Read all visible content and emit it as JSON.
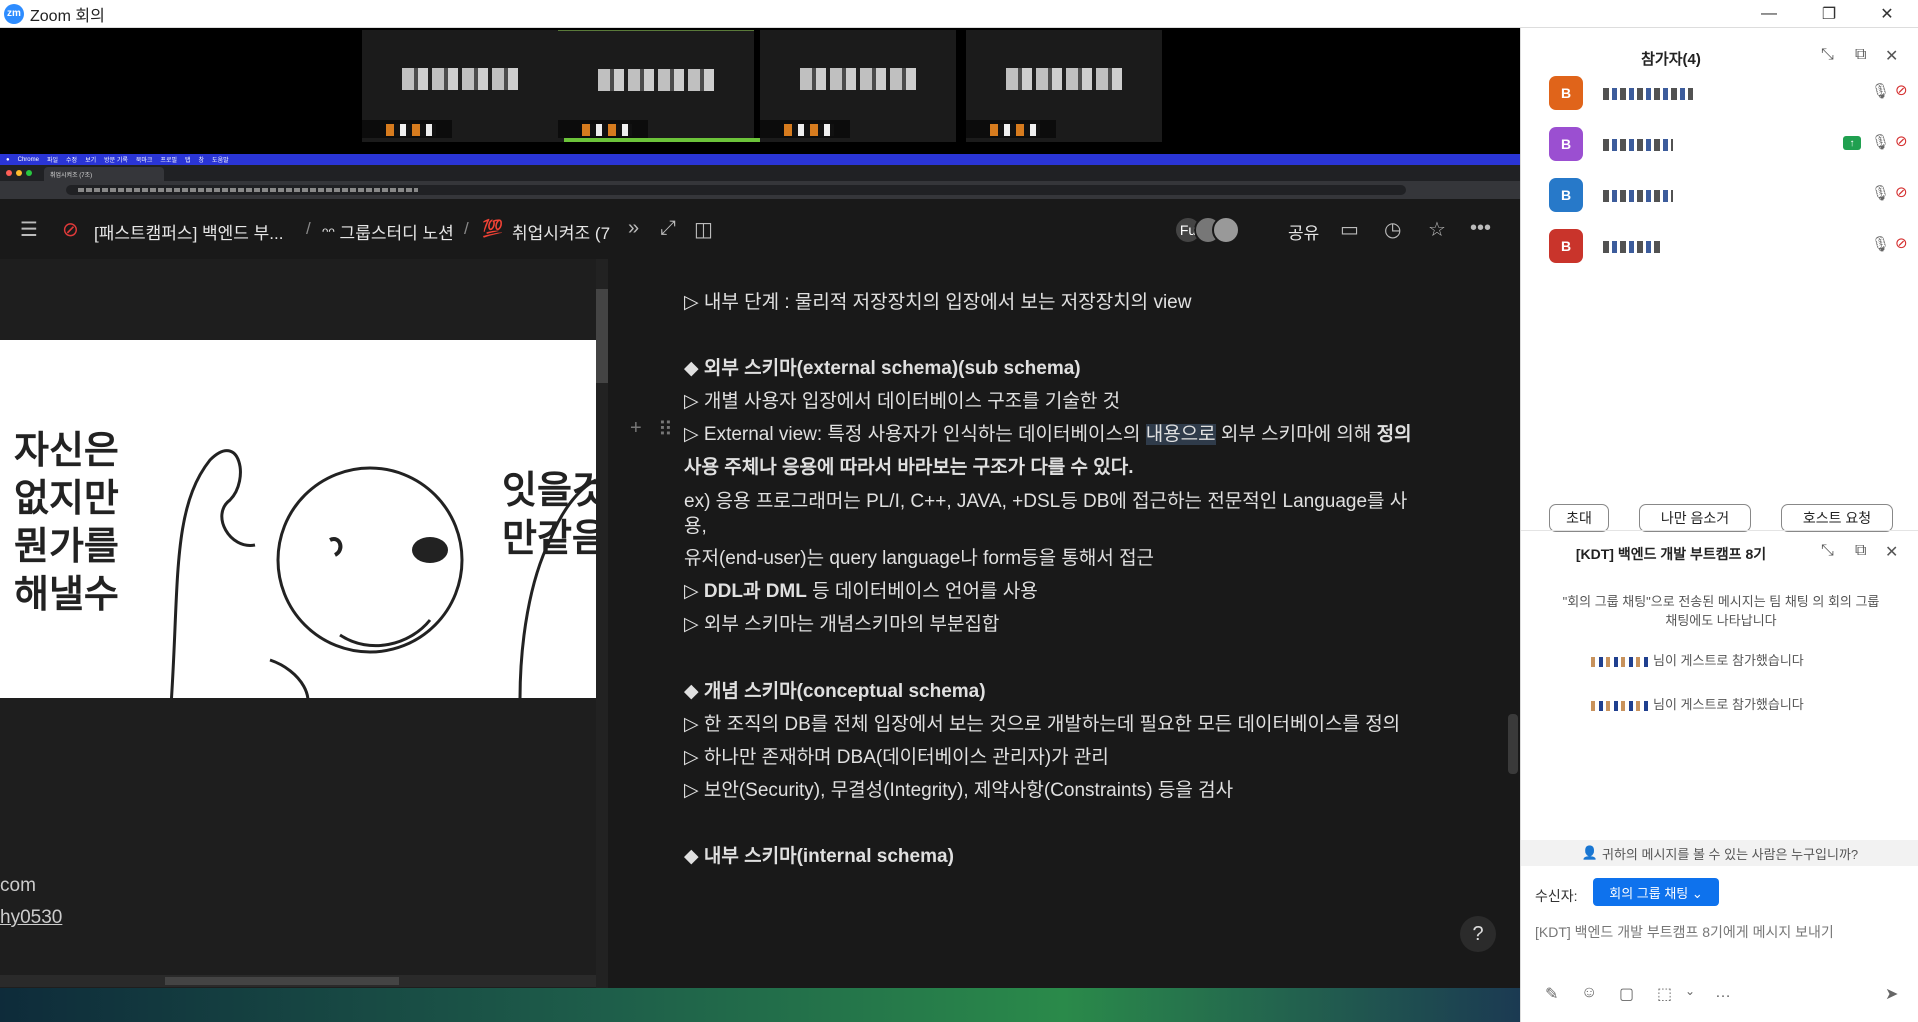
{
  "window": {
    "app_logo": "zm",
    "title": "Zoom 회의",
    "controls": {
      "minimize": "—",
      "restore": "❐",
      "close": "✕"
    }
  },
  "browser": {
    "menubar_app": "Chrome",
    "menubar_items": [
      "파일",
      "수정",
      "보기",
      "방문 기록",
      "북마크",
      "프로필",
      "탭",
      "창",
      "도움말"
    ],
    "tab_label": "취업시켜조 (7조)"
  },
  "notion": {
    "breadcrumb_1": "[패스트캠퍼스] 백엔드 부...",
    "breadcrumb_sep": "/",
    "breadcrumb_2": "ᵔᵔ 그룹스터디 노션",
    "breadcrumb_3_icon": "💯",
    "breadcrumb_3": "취업시켜조 (7",
    "avatar_initial": "Fu",
    "share_label": "공유"
  },
  "left_panel": {
    "meme_left_text": "자신은\n없지만\n뭔가를\n해낼수",
    "meme_right_text": "잇을것\n만같음",
    "footer_1": "com",
    "footer_2": "hy0530"
  },
  "content": {
    "lines": [
      "▷ 내부 단계 : 물리적 저장장치의 입장에서 보는 저장장치의 view",
      "◆ 외부 스키마(external schema)(sub schema)",
      "▷ 개별 사용자 입장에서 데이터베이스 구조를 기술한 것",
      "▷ External view: 특정 사용자가 인식하는 데이터베이스의 ",
      "내용으로",
      " 외부 스키마에 의해 ",
      "정의",
      "사용 주체나 응용에 따라서 바라보는 구조가 다를 수 있다.",
      "ex) 응용 프로그래머는 PL/I, C++, JAVA, +DSL등 DB에 접근하는 전문적인 Language를 사",
      "용,",
      "유저(end-user)는 query language나 form등을 통해서 접근",
      "▷ ",
      "DDL과 DML",
      " 등 데이터베이스 언어를 사용",
      "▷ 외부 스키마는 개념스키마의 부분집합",
      "◆ 개념 스키마(conceptual schema)",
      "▷ 한 조직의  DB를 전체 입장에서 보는 것으로 개발하는데 필요한 모든 데이터베이스를 정의",
      "▷ 하나만 존재하며 DBA(데이터베이스 관리자)가 관리",
      "▷ 보안(Security), 무결성(Integrity), 제약사항(Constraints) 등을 검사",
      "◆ 내부 스키마(internal schema)"
    ],
    "help": "?"
  },
  "participants": {
    "title": "참가자(4)",
    "members": [
      {
        "initial": "B",
        "color": "#e0641a"
      },
      {
        "initial": "B",
        "color": "#9b4fd1"
      },
      {
        "initial": "B",
        "color": "#2779c9"
      },
      {
        "initial": "B",
        "color": "#c9342b"
      }
    ],
    "buttons": {
      "invite": "초대",
      "mute_me": "나만 음소거",
      "host_request": "호스트 요청"
    }
  },
  "chat": {
    "title": "[KDT] 백엔드 개발 부트캠프 8기",
    "info": "\"회의 그룹 채팅\"으로 전송된 메시지는 팀 채팅 의 회의 그룹 채팅에도 나타납니다",
    "join_1": "님이 게스트로 참가했습니다",
    "join_2": "님이 게스트로 참가했습니다",
    "who_can_see": "귀하의 메시지를 볼 수 있는 사람은 누구입니까?",
    "recipient_label": "수신자:",
    "recipient_value": "회의 그룹 채팅 ⌄",
    "input_placeholder": "[KDT] 백엔드 개발 부트캠프 8기에게 메시지 보내기"
  },
  "icons": {
    "collapse": "collapse-icon",
    "popout": "popout-icon",
    "close": "close-icon",
    "mic": "mic-icon",
    "camera_off": "camera-off-icon"
  }
}
